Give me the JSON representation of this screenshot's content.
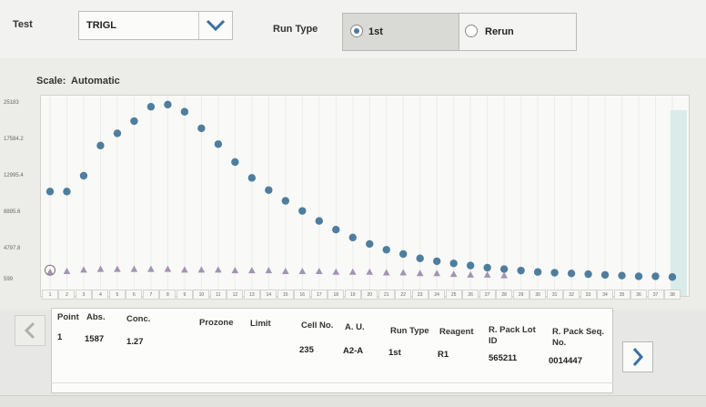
{
  "test": {
    "label": "Test",
    "value": "TRIGL"
  },
  "run_type": {
    "label": "Run Type",
    "options": [
      {
        "label": "1st",
        "selected": true
      },
      {
        "label": "Rerun",
        "selected": false
      }
    ]
  },
  "scale": {
    "label": "Scale:",
    "value": "Automatic"
  },
  "chart_data": {
    "type": "scatter",
    "title": "",
    "xlabel": "",
    "ylabel": "",
    "x_ticks": [
      "1",
      "2",
      "3",
      "4",
      "5",
      "6",
      "7",
      "8",
      "9",
      "10",
      "11",
      "12",
      "13",
      "14",
      "15",
      "16",
      "17",
      "18",
      "19",
      "20",
      "21",
      "22",
      "23",
      "24",
      "25",
      "26",
      "27",
      "28",
      "29",
      "30",
      "31",
      "32",
      "33",
      "34",
      "35",
      "36",
      "37",
      "38"
    ],
    "y_ticks": [
      "25183",
      "17584.2",
      "12995.4",
      "8895.6",
      "4797.8",
      "599"
    ],
    "ylim": [
      599,
      25183
    ],
    "series": [
      {
        "marker": "circle",
        "color": "#4e7e9e",
        "values": [
          13100,
          13100,
          15300,
          19500,
          21200,
          22900,
          24900,
          25200,
          24200,
          21900,
          19700,
          17200,
          15000,
          13300,
          11800,
          10400,
          9000,
          7800,
          6700,
          5800,
          5000,
          4400,
          3800,
          3400,
          3100,
          2800,
          2500,
          2300,
          2100,
          1900,
          1800,
          1700,
          1600,
          1500,
          1400,
          1300,
          1300,
          1200
        ]
      },
      {
        "marker": "triangle",
        "color": "#a393b4",
        "values": [
          1900,
          2000,
          2200,
          2300,
          2300,
          2300,
          2300,
          2300,
          2200,
          2200,
          2200,
          2100,
          2100,
          2100,
          2000,
          2000,
          2000,
          1900,
          1900,
          1900,
          1800,
          1800,
          1700,
          1700,
          1600,
          1500,
          1500,
          1400
        ]
      }
    ]
  },
  "table": {
    "headers": {
      "point": "Point",
      "abs": "Abs.",
      "conc": "Conc.",
      "prozone": "Prozone",
      "limit": "Limit",
      "cell_no": "Cell No.",
      "au": "A. U.",
      "run_type": "Run Type",
      "reagent": "Reagent",
      "rpack_lot": "R. Pack Lot ID",
      "rpack_seq": "R. Pack Seq. No."
    },
    "row": {
      "point": "1",
      "abs": "1587",
      "conc": "1.27",
      "prozone": "",
      "limit": "",
      "cell_no": "235",
      "au": "A2-A",
      "run_type": "1st",
      "reagent": "R1",
      "rpack_lot": "565211",
      "rpack_seq": "0014447"
    }
  },
  "nav": {
    "prev_icon": "chevron-left-icon",
    "next_icon": "chevron-right-icon"
  },
  "colors": {
    "accent": "#3a6fa0",
    "circle": "#4e7e9e",
    "triangle": "#a393b4"
  }
}
